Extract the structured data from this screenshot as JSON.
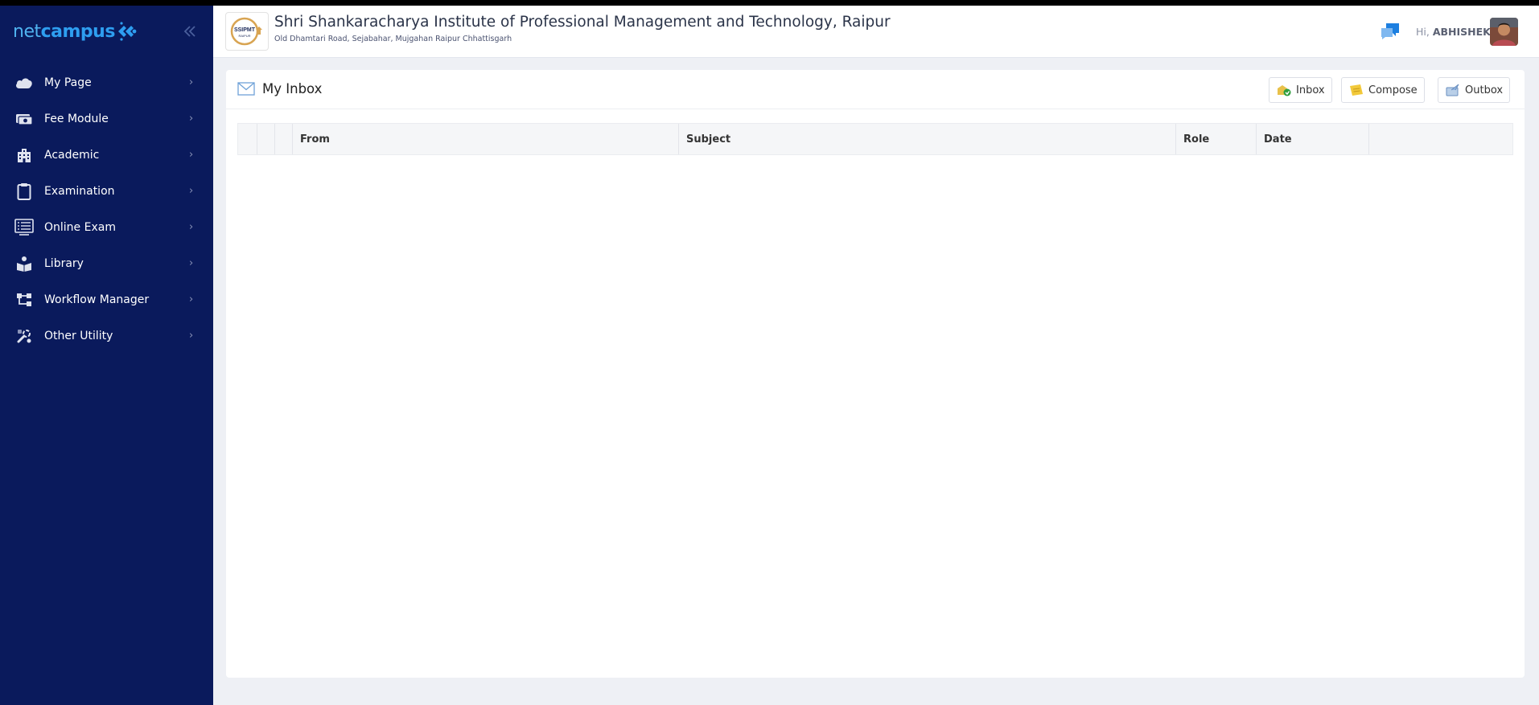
{
  "brand": {
    "net": "net",
    "campus": "campus"
  },
  "sidebar": {
    "items": [
      {
        "label": "My Page",
        "icon": "cloud-icon"
      },
      {
        "label": "Fee Module",
        "icon": "cash-icon"
      },
      {
        "label": "Academic",
        "icon": "building-icon"
      },
      {
        "label": "Examination",
        "icon": "clipboard-icon"
      },
      {
        "label": "Online Exam",
        "icon": "monitor-icon"
      },
      {
        "label": "Library",
        "icon": "reader-icon"
      },
      {
        "label": "Workflow Manager",
        "icon": "workflow-icon"
      },
      {
        "label": "Other Utility",
        "icon": "tools-icon"
      }
    ],
    "chevron": "›",
    "colors": {
      "background": "#0a1a5c",
      "text": "#ffffff"
    }
  },
  "header": {
    "institute_name": "Shri Shankaracharya Institute of Professional Management and Technology, Raipur",
    "address": "Old Dhamtari Road, Sejabahar, Mujgahan Raipur Chhattisgarh",
    "logo_text": "SSIPMT",
    "logo_sub": "RAIPUR",
    "greeting_prefix": "Hi,",
    "user_name": "ABHISHEK"
  },
  "page": {
    "title": "My Inbox",
    "buttons": {
      "inbox": "Inbox",
      "compose": "Compose",
      "outbox": "Outbox"
    },
    "table": {
      "columns": [
        "",
        "",
        "",
        "From",
        "Subject",
        "Role",
        "Date",
        ""
      ]
    }
  }
}
